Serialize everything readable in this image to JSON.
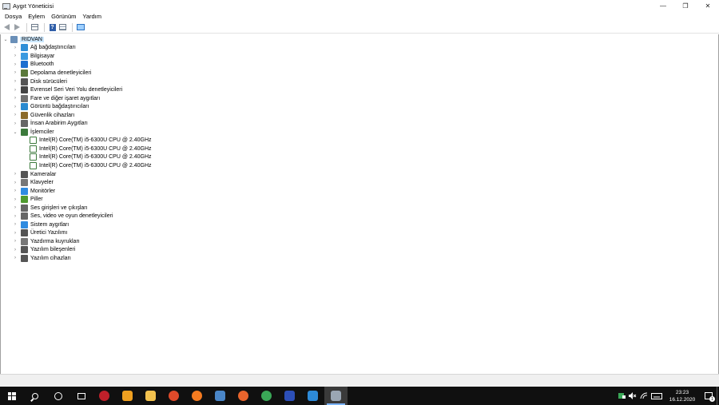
{
  "window": {
    "title": "Aygıt Yöneticisi",
    "minimize_glyph": "—",
    "restore_glyph": "❐",
    "close_glyph": "✕"
  },
  "menu": [
    "Dosya",
    "Eylem",
    "Görünüm",
    "Yardım"
  ],
  "toolbar": {
    "buttons": [
      "back-icon",
      "forward-icon",
      "show-hide-console-tree-icon",
      "help-icon",
      "properties-icon",
      "scan-hardware-icon"
    ]
  },
  "tree": {
    "root": "RIDVAN",
    "categories": [
      {
        "label": "Ağ bağdaştırıcıları",
        "icon": "network-adapter-icon",
        "color": "#2e8fd8"
      },
      {
        "label": "Bilgisayar",
        "icon": "computer-icon",
        "color": "#3a9ae0"
      },
      {
        "label": "Bluetooth",
        "icon": "bluetooth-icon",
        "color": "#1d6fd0"
      },
      {
        "label": "Depolama denetleyicileri",
        "icon": "storage-controller-icon",
        "color": "#5c7a3c"
      },
      {
        "label": "Disk sürücüleri",
        "icon": "disk-drive-icon",
        "color": "#555555"
      },
      {
        "label": "Evrensel Seri Veri Yolu denetleyicileri",
        "icon": "usb-icon",
        "color": "#444444"
      },
      {
        "label": "Fare ve diğer işaret aygıtları",
        "icon": "mouse-icon",
        "color": "#707070"
      },
      {
        "label": "Görüntü bağdaştırıcıları",
        "icon": "display-adapter-icon",
        "color": "#2a8ad0"
      },
      {
        "label": "Güvenlik cihazları",
        "icon": "security-device-icon",
        "color": "#8a6a2a"
      },
      {
        "label": "İnsan Arabirim Aygıtları",
        "icon": "hid-icon",
        "color": "#666666"
      },
      {
        "label": "İşlemciler",
        "icon": "processor-icon",
        "color": "#3c7a3c",
        "expanded": true,
        "children": [
          "Intel(R) Core(TM) i5-6300U CPU @ 2.40GHz",
          "Intel(R) Core(TM) i5-6300U CPU @ 2.40GHz",
          "Intel(R) Core(TM) i5-6300U CPU @ 2.40GHz",
          "Intel(R) Core(TM) i5-6300U CPU @ 2.40GHz"
        ]
      },
      {
        "label": "Kameralar",
        "icon": "camera-icon",
        "color": "#555555"
      },
      {
        "label": "Klavyeler",
        "icon": "keyboard-icon",
        "color": "#777777"
      },
      {
        "label": "Monitörler",
        "icon": "monitor-icon",
        "color": "#2f8be0"
      },
      {
        "label": "Piller",
        "icon": "battery-icon",
        "color": "#4f9a2f"
      },
      {
        "label": "Ses girişleri ve çıkışları",
        "icon": "audio-io-icon",
        "color": "#666666"
      },
      {
        "label": "Ses, video ve oyun denetleyicileri",
        "icon": "sound-video-icon",
        "color": "#666666"
      },
      {
        "label": "Sistem aygıtları",
        "icon": "system-device-icon",
        "color": "#2f8be0"
      },
      {
        "label": "Üretici Yazılımı",
        "icon": "firmware-icon",
        "color": "#555555"
      },
      {
        "label": "Yazdırma kuyrukları",
        "icon": "print-queue-icon",
        "color": "#777777"
      },
      {
        "label": "Yazılım bileşenleri",
        "icon": "software-component-icon",
        "color": "#555555"
      },
      {
        "label": "Yazılım cihazları",
        "icon": "software-device-icon",
        "color": "#555555"
      }
    ]
  },
  "taskbar": {
    "apps": [
      {
        "name": "start-icon"
      },
      {
        "name": "search-icon"
      },
      {
        "name": "cortana-icon"
      },
      {
        "name": "task-view-icon"
      },
      {
        "name": "app-red-shield-icon",
        "color": "#c0202a"
      },
      {
        "name": "app-orange-triangle-icon",
        "color": "#f0a020"
      },
      {
        "name": "file-explorer-icon",
        "color": "#f2c14e"
      },
      {
        "name": "app-arc-icon",
        "color": "#e04a2a"
      },
      {
        "name": "app-orange-circle-icon",
        "color": "#f47b20"
      },
      {
        "name": "calculator-icon",
        "color": "#4a86c8"
      },
      {
        "name": "firefox-icon",
        "color": "#e8642c"
      },
      {
        "name": "chrome-icon",
        "color": "#3aa757"
      },
      {
        "name": "app-x-icon",
        "color": "#2c4fb8"
      },
      {
        "name": "mail-icon",
        "color": "#2d8ad8"
      },
      {
        "name": "device-manager-taskbar-icon",
        "color": "#9aa6b4",
        "active": true
      }
    ],
    "clock_time": "23:23",
    "clock_date": "16.12.2020",
    "notification_count": "1"
  }
}
